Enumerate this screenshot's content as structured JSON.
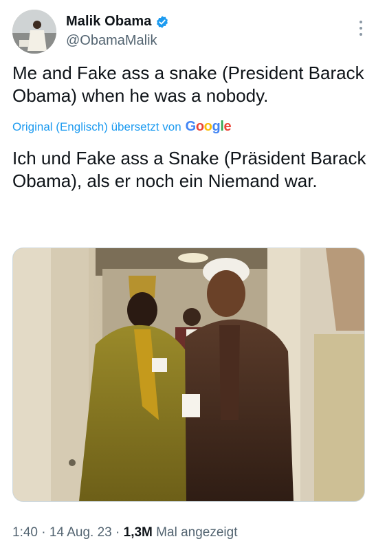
{
  "author": {
    "name": "Malik Obama",
    "handle": "@ObamaMalik"
  },
  "tweet": {
    "text": "Me and Fake ass a snake (President Barack Obama) when he was a nobody.",
    "translation_notice": "Original (Englisch) übersetzt von",
    "translation_provider": "Google",
    "translated_text": "Ich und Fake ass a Snake (Präsident Barack Obama), als er noch ein Niemand war."
  },
  "meta": {
    "time": "1:40",
    "date": "14 Aug. 23",
    "views": "1,3M",
    "views_label": "Mal angezeigt",
    "separator": "·"
  },
  "colors": {
    "link": "#1d9bf0",
    "secondary_text": "#536471",
    "verified": "#1d9bf0"
  },
  "icons": {
    "verified": "verified-badge-icon",
    "more": "more-options-icon"
  }
}
